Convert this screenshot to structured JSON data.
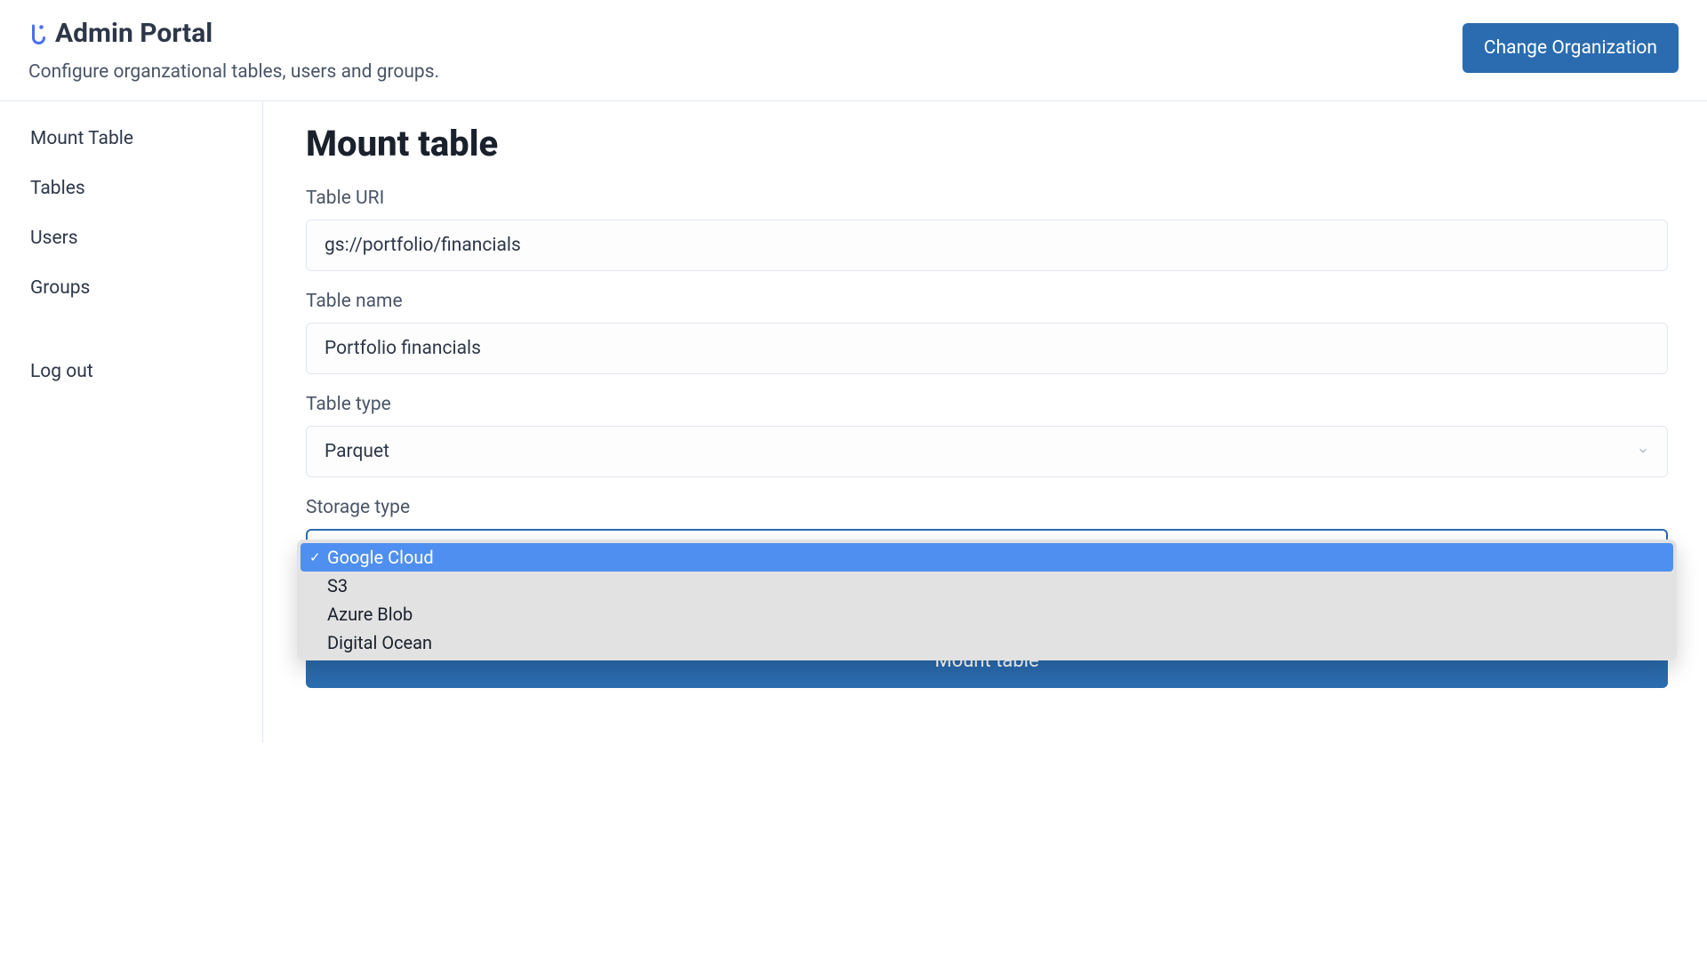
{
  "header": {
    "title": "Admin Portal",
    "subtitle": "Configure organzational tables, users and groups.",
    "change_org_label": "Change Organization"
  },
  "sidebar": {
    "items": [
      {
        "label": "Mount Table"
      },
      {
        "label": "Tables"
      },
      {
        "label": "Users"
      },
      {
        "label": "Groups"
      },
      {
        "label": "Log out"
      }
    ]
  },
  "main": {
    "title": "Mount table",
    "fields": {
      "table_uri": {
        "label": "Table URI",
        "value": "gs://portfolio/financials"
      },
      "table_name": {
        "label": "Table name",
        "value": "Portfolio financials"
      },
      "table_type": {
        "label": "Table type",
        "value": "Parquet"
      },
      "storage_type": {
        "label": "Storage type",
        "selected": "Google Cloud",
        "options": [
          "Google Cloud",
          "S3",
          "Azure Blob",
          "Digital Ocean"
        ]
      }
    },
    "submit_label": "Mount table"
  }
}
